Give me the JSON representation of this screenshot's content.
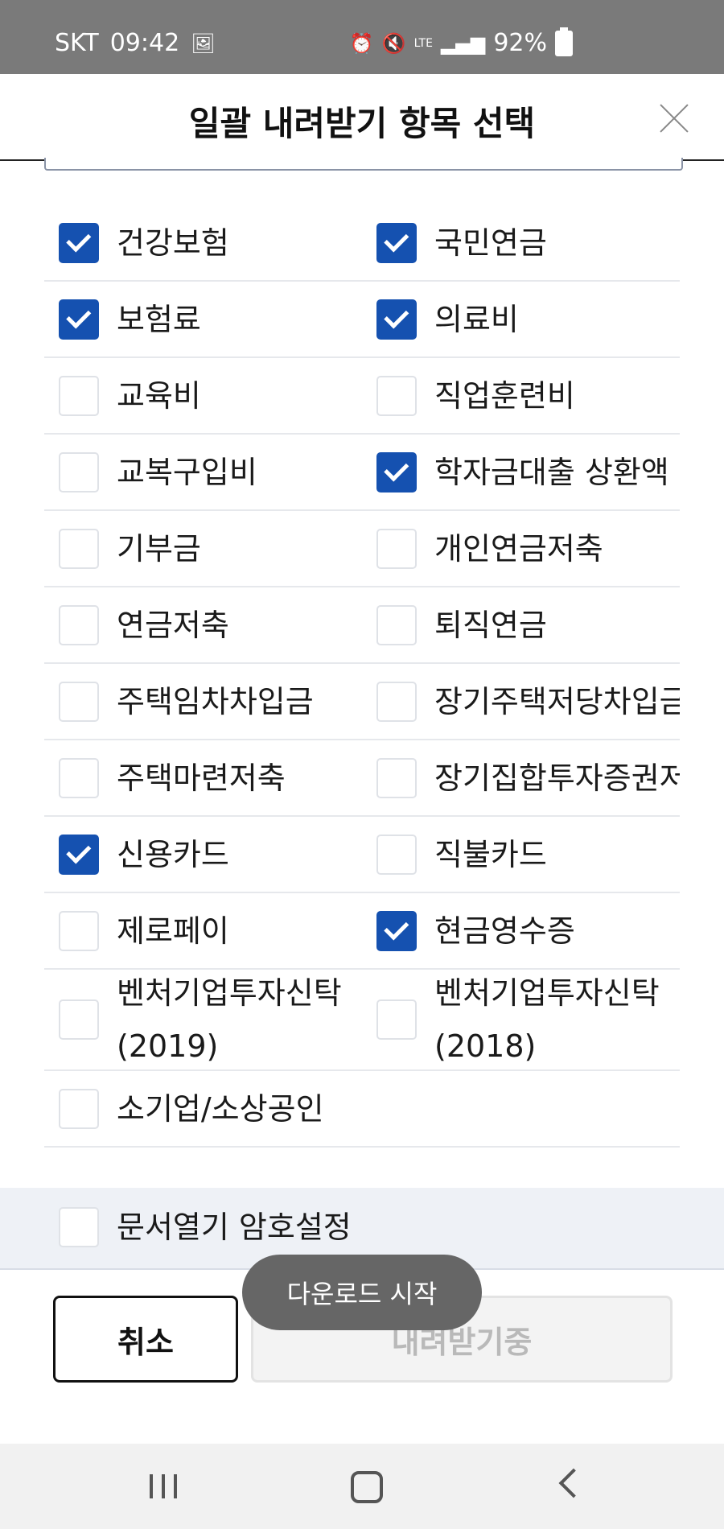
{
  "status_bar": {
    "carrier": "SKT",
    "time": "09:42",
    "network": "LTE",
    "battery": "92%",
    "icons": [
      "image-icon",
      "alarm-icon",
      "mute-icon",
      "lte-icon",
      "signal-icon",
      "battery-icon"
    ]
  },
  "header": {
    "title": "일괄 내려받기 항목 선택",
    "close_icon": "close-icon"
  },
  "items": [
    {
      "label": "건강보험",
      "checked": true
    },
    {
      "label": "국민연금",
      "checked": true
    },
    {
      "label": "보험료",
      "checked": true
    },
    {
      "label": "의료비",
      "checked": true
    },
    {
      "label": "교육비",
      "checked": false
    },
    {
      "label": "직업훈련비",
      "checked": false
    },
    {
      "label": "교복구입비",
      "checked": false
    },
    {
      "label": "학자금대출 상환액",
      "checked": true
    },
    {
      "label": "기부금",
      "checked": false
    },
    {
      "label": "개인연금저축",
      "checked": false
    },
    {
      "label": "연금저축",
      "checked": false
    },
    {
      "label": "퇴직연금",
      "checked": false
    },
    {
      "label": "주택임차차입금",
      "checked": false
    },
    {
      "label": "장기주택저당차입금",
      "checked": false
    },
    {
      "label": "주택마련저축",
      "checked": false
    },
    {
      "label": "장기집합투자증권저",
      "checked": false
    },
    {
      "label": "신용카드",
      "checked": true
    },
    {
      "label": "직불카드",
      "checked": false
    },
    {
      "label": "제로페이",
      "checked": false
    },
    {
      "label": "현금영수증",
      "checked": true
    },
    {
      "label": "벤처기업투자신탁\n(2019)",
      "checked": false
    },
    {
      "label": "벤처기업투자신탁\n(2018)",
      "checked": false
    },
    {
      "label": "소기업/소상공인",
      "checked": false
    }
  ],
  "password_option": {
    "label": "문서열기 암호설정",
    "checked": false
  },
  "buttons": {
    "cancel": "취소",
    "download": "내려받기중"
  },
  "toast": "다운로드 시작",
  "colors": {
    "checked_fill": "#1551b0",
    "status_bar_bg": "#7a7a7a",
    "toast_bg": "#666666"
  }
}
